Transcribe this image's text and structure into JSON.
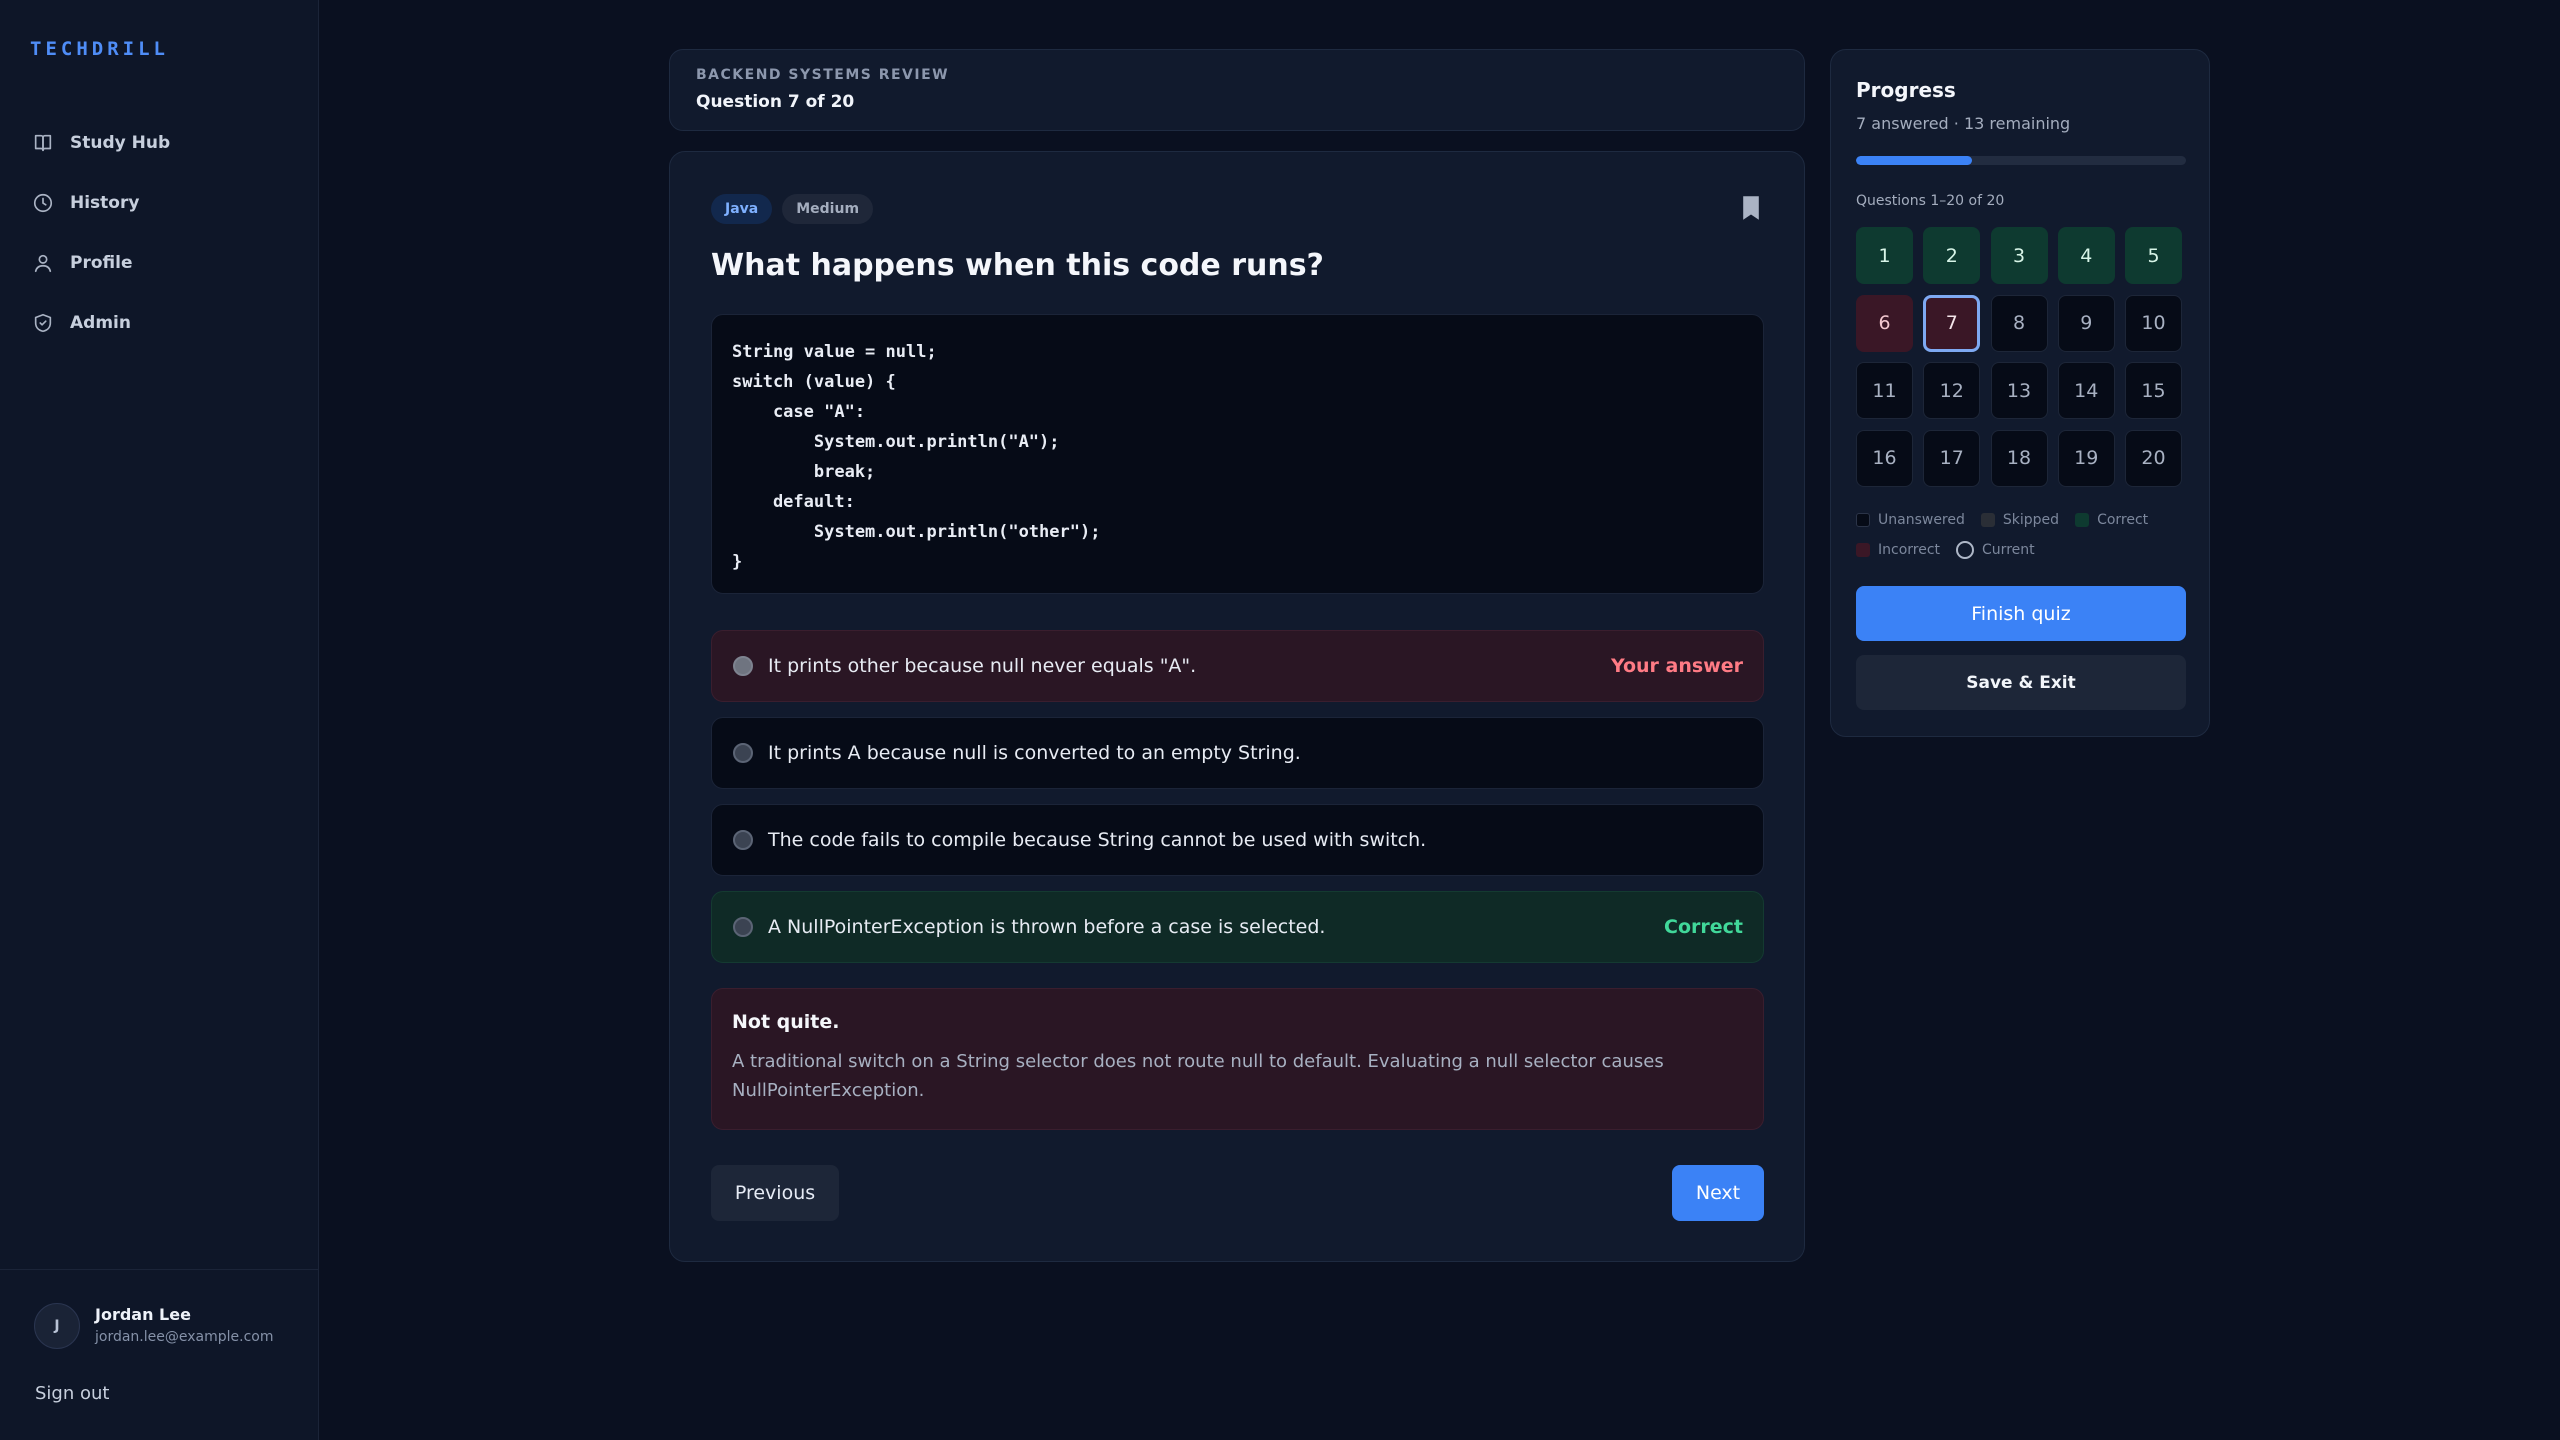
{
  "brand": "TECHDRILL",
  "sidebar": {
    "items": [
      {
        "label": "Study Hub",
        "icon": "book-icon"
      },
      {
        "label": "History",
        "icon": "clock-icon"
      },
      {
        "label": "Profile",
        "icon": "user-icon"
      },
      {
        "label": "Admin",
        "icon": "shield-icon"
      }
    ],
    "user": {
      "initial": "J",
      "name": "Jordan Lee",
      "email": "jordan.lee@example.com"
    },
    "signout_label": "Sign out"
  },
  "header": {
    "eyebrow": "BACKEND SYSTEMS REVIEW",
    "question_count": "Question 7 of 20"
  },
  "question": {
    "tags": [
      "Java",
      "Medium"
    ],
    "title": "What happens when this code runs?",
    "code_lines": [
      "String value = null;",
      "switch (value) {",
      "    case \"A\":",
      "        System.out.println(\"A\");",
      "        break;",
      "    default:",
      "        System.out.println(\"other\");",
      "}"
    ],
    "options": [
      {
        "text": "It prints other because null never equals \"A\".",
        "status": "Your answer"
      },
      {
        "text": "It prints A because null is converted to an empty String.",
        "status": ""
      },
      {
        "text": "The code fails to compile because String cannot be used with switch.",
        "status": ""
      },
      {
        "text": "A NullPointerException is thrown before a case is selected.",
        "status": "Correct"
      }
    ],
    "feedback": {
      "title": "Not quite.",
      "body": "A traditional switch on a String selector does not route null to default. Evaluating a null selector causes NullPointerException."
    },
    "prev_label": "Previous",
    "next_label": "Next"
  },
  "progress": {
    "title": "Progress",
    "summary": "7 answered · 13 remaining",
    "fraction": 0.35,
    "range_label": "Questions 1–20 of 20",
    "questions": [
      {
        "n": "1",
        "state": "correct"
      },
      {
        "n": "2",
        "state": "correct"
      },
      {
        "n": "3",
        "state": "correct"
      },
      {
        "n": "4",
        "state": "correct"
      },
      {
        "n": "5",
        "state": "correct"
      },
      {
        "n": "6",
        "state": "incorrect"
      },
      {
        "n": "7",
        "state": "current"
      },
      {
        "n": "8",
        "state": "unanswered"
      },
      {
        "n": "9",
        "state": "unanswered"
      },
      {
        "n": "10",
        "state": "unanswered"
      },
      {
        "n": "11",
        "state": "unanswered"
      },
      {
        "n": "12",
        "state": "unanswered"
      },
      {
        "n": "13",
        "state": "unanswered"
      },
      {
        "n": "14",
        "state": "unanswered"
      },
      {
        "n": "15",
        "state": "unanswered"
      },
      {
        "n": "16",
        "state": "unanswered"
      },
      {
        "n": "17",
        "state": "unanswered"
      },
      {
        "n": "18",
        "state": "unanswered"
      },
      {
        "n": "19",
        "state": "unanswered"
      },
      {
        "n": "20",
        "state": "unanswered"
      }
    ],
    "legend": {
      "unanswered": "Unanswered",
      "skipped": "Skipped",
      "correct": "Correct",
      "incorrect": "Incorrect",
      "current": "Current"
    },
    "finish_label": "Finish quiz",
    "save_label": "Save & Exit"
  },
  "colors": {
    "accent": "#3b82f6",
    "correct": "#41d89a",
    "incorrect": "#ff7b85"
  }
}
